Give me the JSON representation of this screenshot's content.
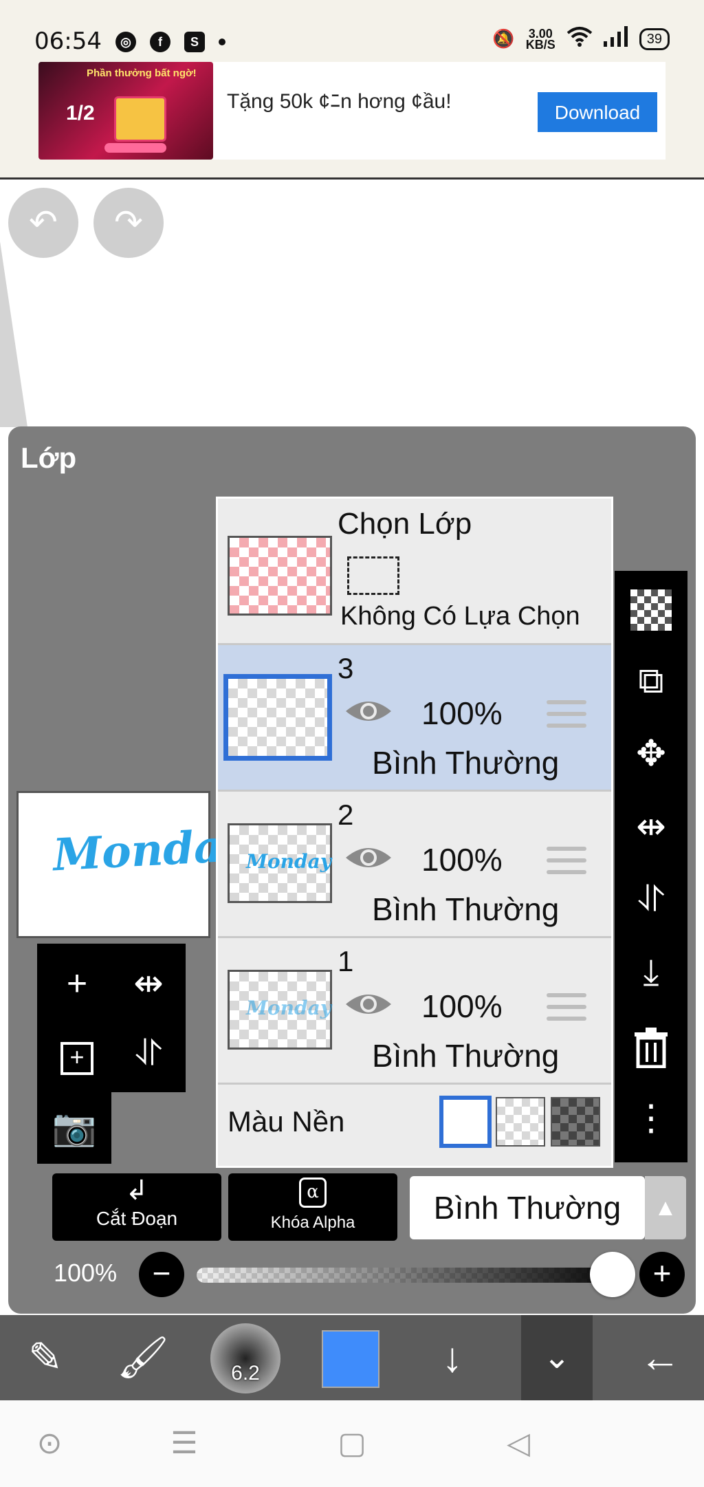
{
  "status_bar": {
    "time": "06:54",
    "net_speed": "3.00",
    "net_unit": "KB/S",
    "battery": "39",
    "icons": [
      "chrome-icon",
      "facebook-icon",
      "shopee-icon",
      "dot-icon",
      "mute-icon",
      "wifi-icon",
      "signal-icon",
      "battery-icon"
    ]
  },
  "ad": {
    "text": "Tặng 50k ¢ﾆn hơng ¢ầu!",
    "button": "Download",
    "image_caption": "Phần thưởng bất ngờ!",
    "image_price": "1/2"
  },
  "canvas": {
    "undo_icon": "undo-icon",
    "redo_icon": "redo-icon"
  },
  "panel": {
    "title": "Lớp",
    "preview_text": "Monday",
    "selection": {
      "title": "Chọn Lớp",
      "status": "Không Có Lựa Chọn"
    },
    "layers": [
      {
        "number": "3",
        "opacity": "100%",
        "blend": "Bình Thường",
        "selected": true,
        "thumb_text": ""
      },
      {
        "number": "2",
        "opacity": "100%",
        "blend": "Bình Thường",
        "selected": false,
        "thumb_text": "Monday"
      },
      {
        "number": "1",
        "opacity": "100%",
        "blend": "Bình Thường",
        "selected": false,
        "thumb_text": "Monday"
      }
    ],
    "background_label": "Màu Nền",
    "clip_label": "Cắt Đoạn",
    "alpha_lock_label": "Khóa Alpha",
    "alpha_symbol": "α",
    "blend_mode": "Bình Thường",
    "opacity_label": "100%",
    "opacity_value": 1.0
  },
  "bottom_toolbar": {
    "brush_size": "6.2",
    "color": "#3f8cfb"
  },
  "colors": {
    "panel_bg": "#7d7d7d",
    "selected_row": "#c8d6ec",
    "accent": "#2f6fd6"
  }
}
